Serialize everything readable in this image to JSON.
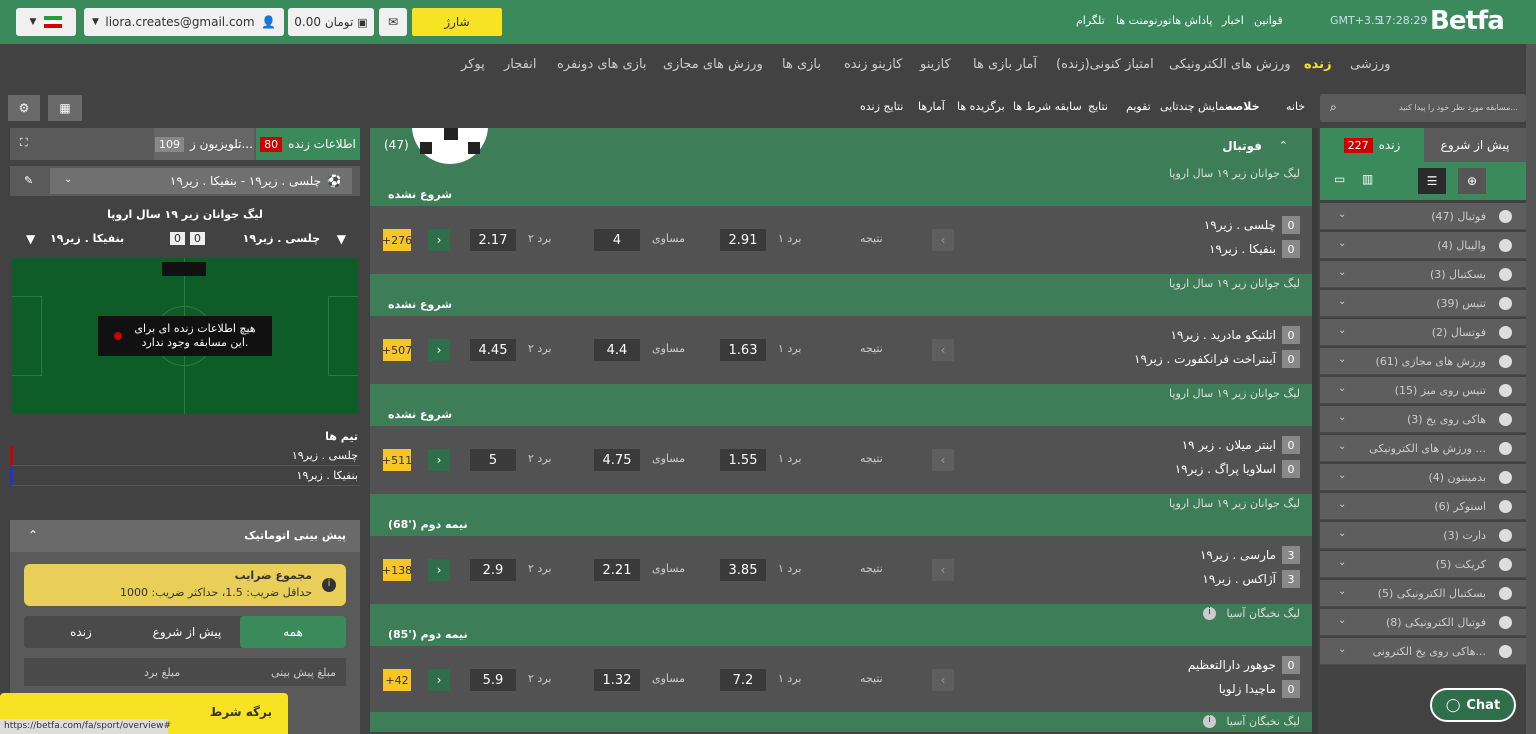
{
  "topbar": {
    "charge_label": "شارژ",
    "balance": "0.00 تومان",
    "email": "liora.creates@gmail.com",
    "links": [
      "قوانین",
      "اخبار",
      "پاداش ها",
      "تورنومنت ها",
      "تلگرام"
    ],
    "timezone": "GMT+3.5",
    "time": "17:28:29",
    "logo": "Betfa"
  },
  "nav": {
    "items": [
      "ورزشی",
      "زنده",
      "ورزش های الکترونیکی",
      "امتیاز کنونی(زنده)",
      "آمار بازی ها",
      "کازینو",
      "کازینو زنده",
      "بازی ها",
      "ورزش های مجازی",
      "بازی های دونفره",
      "انفجار",
      "پوکر"
    ],
    "active": "زنده"
  },
  "breadcrumb": [
    "خانه",
    "خلاصه",
    "نمایش چندتایی",
    "تقویم",
    "نتایج",
    "سابقه شرط ها",
    "برگزیده ها",
    "آمارها",
    "نتایج زنده"
  ],
  "sidebar": {
    "search_placeholder": "مسابقه مورد نظر خود را پیدا کنید...",
    "tab_prematch": "پیش از شروع",
    "tab_live": "زنده",
    "live_count": "227",
    "sports": [
      "فوتبال (47)",
      "والیبال (4)",
      "بسکتبال (3)",
      "تنیس (39)",
      "فوتسال (2)",
      "ورزش های مجازی (61)",
      "تنیس روی میز (15)",
      "هاکی روی یخ (3)",
      "ورزش های الکترونیکی ...",
      "بدمینتون (4)",
      "اسنوکر (6)",
      "دارت (3)",
      "کریکت (5)",
      "بسکتبال الکترونیکی (5)",
      "فوتبال الکترونیکی (8)",
      "هاکی روی یخ الکترونی..."
    ],
    "chat": "Chat"
  },
  "main": {
    "sport_title": "فوتبال",
    "sport_count": "(47)",
    "result_label": "نتیجه",
    "win1_label": "برد ۱",
    "draw_label": "مساوی",
    "win2_label": "برد ۲",
    "matches": [
      {
        "league": "لیگ جوانان زیر ۱۹ سال اروپا",
        "status": "شروع نشده",
        "team1": "چلسی . زیر۱۹",
        "team2": "بنفیکا . زیر۱۹",
        "s1": "0",
        "s2": "0",
        "w1": "2.91",
        "d": "4",
        "w2": "2.17",
        "more": "+276"
      },
      {
        "league": "لیگ جوانان زیر ۱۹ سال اروپا",
        "status": "شروع نشده",
        "team1": "اتلتیکو مادرید . زیر۱۹",
        "team2": "آینتراخت فرانکفورت . زیر۱۹",
        "s1": "0",
        "s2": "0",
        "w1": "1.63",
        "d": "4.4",
        "w2": "4.45",
        "more": "+507"
      },
      {
        "league": "لیگ جوانان زیر ۱۹ سال اروپا",
        "status": "شروع نشده",
        "team1": "اینتر میلان . زیر ۱۹",
        "team2": "اسلاویا پراگ . زیر۱۹",
        "s1": "0",
        "s2": "0",
        "w1": "1.55",
        "d": "4.75",
        "w2": "5",
        "more": "+511"
      },
      {
        "league": "لیگ جوانان زیر ۱۹ سال اروپا",
        "status": "نیمه دوم ('68)",
        "team1": "مارسی . زیر۱۹",
        "team2": "آژاکس . زیر۱۹",
        "s1": "3",
        "s2": "3",
        "w1": "3.85",
        "d": "2.21",
        "w2": "2.9",
        "more": "+138"
      },
      {
        "league": "لیگ نخبگان آسیا",
        "status": "نیمه دوم ('85)",
        "team1": "جوهور دارالتعظیم",
        "team2": "ماچیدا زلویا",
        "s1": "0",
        "s2": "0",
        "w1": "7.2",
        "d": "1.32",
        "w2": "5.9",
        "more": "+42"
      }
    ],
    "last_league": "لیگ نخبگان آسیا"
  },
  "left": {
    "live_info_label": "اطلاعات زنده",
    "live_info_count": "80",
    "tv_label": "تلویزیون ز...",
    "tv_count": "109",
    "selected_match": "چلسی . زیر۱۹ - بنفیکا . زیر۱۹",
    "league_title": "لیگ جوانان زیر ۱۹ سال اروپا",
    "home": "چلسی . زیر۱۹",
    "away": "بنفیکا . زیر۱۹",
    "score_home": "0",
    "score_away": "0",
    "no_info_line1": "هیچ اطلاعات زنده ای برای",
    "no_info_line2": "این مسابقه وجود ندارد.",
    "teams_title": "تیم ها",
    "team_list": [
      "چلسی . زیر۱۹",
      "بنفیکا . زیر۱۹"
    ],
    "auto_predict": "پیش بینی اتوماتیک",
    "odds_sum_title": "مجموع ضرایب",
    "odds_sum_desc": "حداقل ضریب: 1.5، حداکثر ضریب: 1000",
    "filter_all": "همه",
    "filter_prematch": "پیش از شروع",
    "filter_live": "زنده",
    "col_predict_amount": "مبلغ پیش بینی",
    "col_win_amount": "مبلغ برد",
    "betslip": "برگه شرط",
    "status_url": "https://betfa.com/fa/sport/overview#"
  }
}
